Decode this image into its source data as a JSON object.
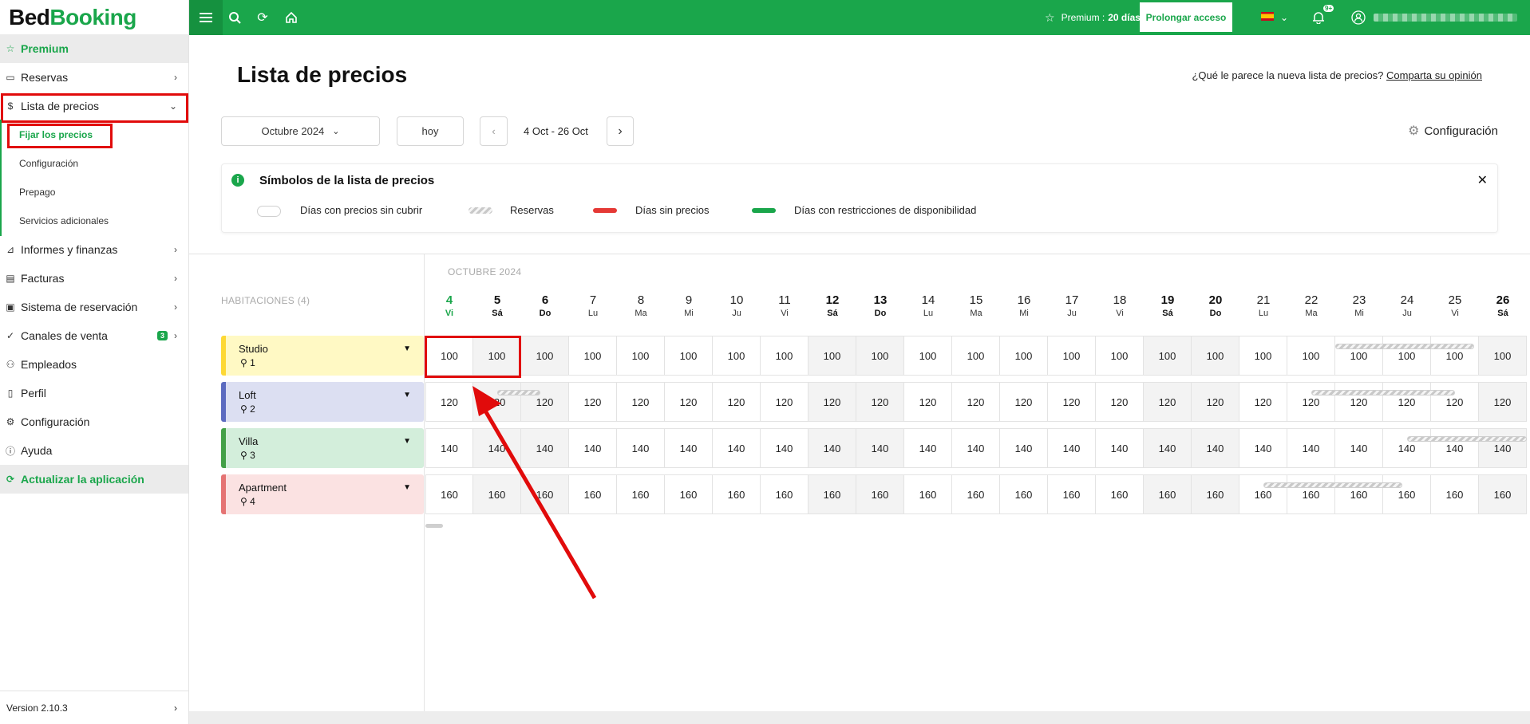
{
  "logo": {
    "part1": "Bed",
    "part2": "Booking"
  },
  "sidebar": {
    "premium": "Premium",
    "items": [
      {
        "label": "Reservas",
        "icon": "calendar-icon"
      },
      {
        "label": "Lista de precios",
        "icon": "dollar-icon"
      },
      {
        "label": "Informes y finanzas",
        "icon": "chart-icon"
      },
      {
        "label": "Facturas",
        "icon": "invoice-icon"
      },
      {
        "label": "Sistema de reservación",
        "icon": "booking-system-icon"
      },
      {
        "label": "Canales de venta",
        "icon": "channels-icon",
        "badge": "3"
      },
      {
        "label": "Empleados",
        "icon": "users-icon"
      },
      {
        "label": "Perfil",
        "icon": "profile-icon"
      },
      {
        "label": "Configuración",
        "icon": "gear-icon"
      },
      {
        "label": "Ayuda",
        "icon": "help-icon"
      }
    ],
    "subitems": [
      "Fijar los precios",
      "Configuración",
      "Prepago",
      "Servicios adicionales"
    ],
    "update": "Actualizar la aplicación",
    "version": "Version 2.10.3"
  },
  "topbar": {
    "premium_label": "Premium :",
    "premium_days": "20 días",
    "prolong": "Prolongar acceso",
    "notif_badge": "9+"
  },
  "page": {
    "title": "Lista de precios",
    "feedback_q": "¿Qué le parece la nueva lista de precios?",
    "feedback_link": "Comparta su opinión",
    "month_select": "Octubre 2024",
    "today_btn": "hoy",
    "date_range": "4 Oct - 26 Oct",
    "config": "Configuración"
  },
  "legend": {
    "title": "Símbolos de la lista de precios",
    "items": [
      "Días con precios sin cubrir",
      "Reservas",
      "Días sin precios",
      "Días con restricciones de disponibilidad"
    ],
    "colors": {
      "no_price": "#e53935",
      "restriction": "#1aa64b"
    }
  },
  "calendar": {
    "month_label": "OCTUBRE 2024",
    "rooms_header": "HABITACIONES (4)",
    "days": [
      {
        "n": "4",
        "w": "Vi"
      },
      {
        "n": "5",
        "w": "Sá"
      },
      {
        "n": "6",
        "w": "Do"
      },
      {
        "n": "7",
        "w": "Lu"
      },
      {
        "n": "8",
        "w": "Ma"
      },
      {
        "n": "9",
        "w": "Mi"
      },
      {
        "n": "10",
        "w": "Ju"
      },
      {
        "n": "11",
        "w": "Vi"
      },
      {
        "n": "12",
        "w": "Sá"
      },
      {
        "n": "13",
        "w": "Do"
      },
      {
        "n": "14",
        "w": "Lu"
      },
      {
        "n": "15",
        "w": "Ma"
      },
      {
        "n": "16",
        "w": "Mi"
      },
      {
        "n": "17",
        "w": "Ju"
      },
      {
        "n": "18",
        "w": "Vi"
      },
      {
        "n": "19",
        "w": "Sá"
      },
      {
        "n": "20",
        "w": "Do"
      },
      {
        "n": "21",
        "w": "Lu"
      },
      {
        "n": "22",
        "w": "Ma"
      },
      {
        "n": "23",
        "w": "Mi"
      },
      {
        "n": "24",
        "w": "Ju"
      },
      {
        "n": "25",
        "w": "Vi"
      },
      {
        "n": "26",
        "w": "Sá"
      }
    ],
    "rooms": [
      {
        "name": "Studio",
        "capacity": "1",
        "price": "100",
        "color": "#fdd835",
        "bg": "#fff9c4"
      },
      {
        "name": "Loft",
        "capacity": "2",
        "price": "120",
        "color": "#5c6bc0",
        "bg": "#dcdff2"
      },
      {
        "name": "Villa",
        "capacity": "3",
        "price": "140",
        "color": "#43a047",
        "bg": "#d3eedb"
      },
      {
        "name": "Apartment",
        "capacity": "4",
        "price": "160",
        "color": "#e57373",
        "bg": "#fbe2e2"
      }
    ]
  }
}
